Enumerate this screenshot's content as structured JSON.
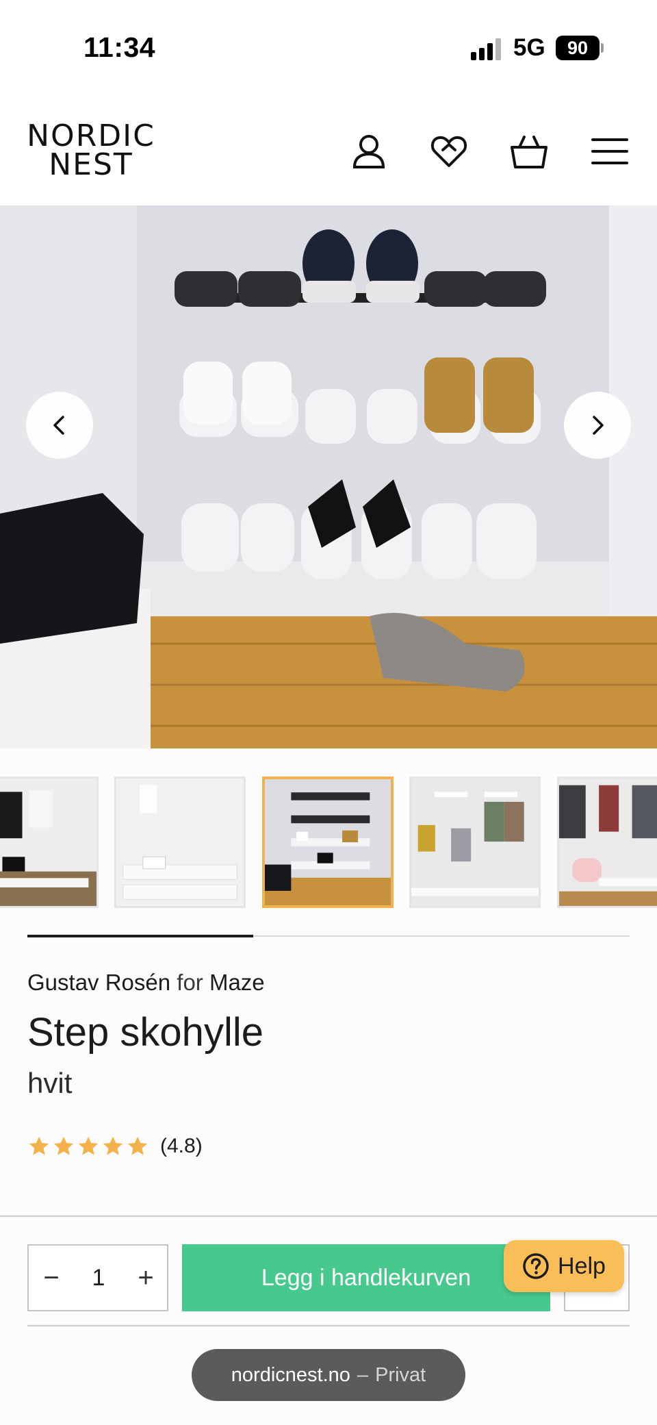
{
  "status_bar": {
    "time": "11:34",
    "network": "5G",
    "battery": "90"
  },
  "header": {
    "logo_line1": "NORDIC",
    "logo_line2": "NEST",
    "icons": [
      "user-icon",
      "heart-icon",
      "basket-icon",
      "menu-icon"
    ]
  },
  "gallery": {
    "slide_count": 5,
    "active_slide": 3,
    "scroll_progress": 0.375,
    "prev_icon": "chevron-left-icon",
    "next_icon": "chevron-right-icon"
  },
  "product": {
    "designer": "Gustav Rosén",
    "for_word": "for",
    "brand": "Maze",
    "title": "Step skohylle",
    "color": "hvit",
    "rating_value": 4.8,
    "rating_text": "(4.8)",
    "stars": 5
  },
  "purchase": {
    "quantity": "1",
    "minus_label": "−",
    "plus_label": "+",
    "add_to_cart_label": "Legg i handlekurven",
    "help_label": "Help"
  },
  "browser": {
    "domain": "nordicnest.no",
    "separator": "–",
    "mode": "Privat"
  },
  "colors": {
    "accent_green": "#47c98d",
    "help_yellow": "#f9be57",
    "active_thumb_border": "#f1b24c",
    "star": "#f5b14a"
  }
}
